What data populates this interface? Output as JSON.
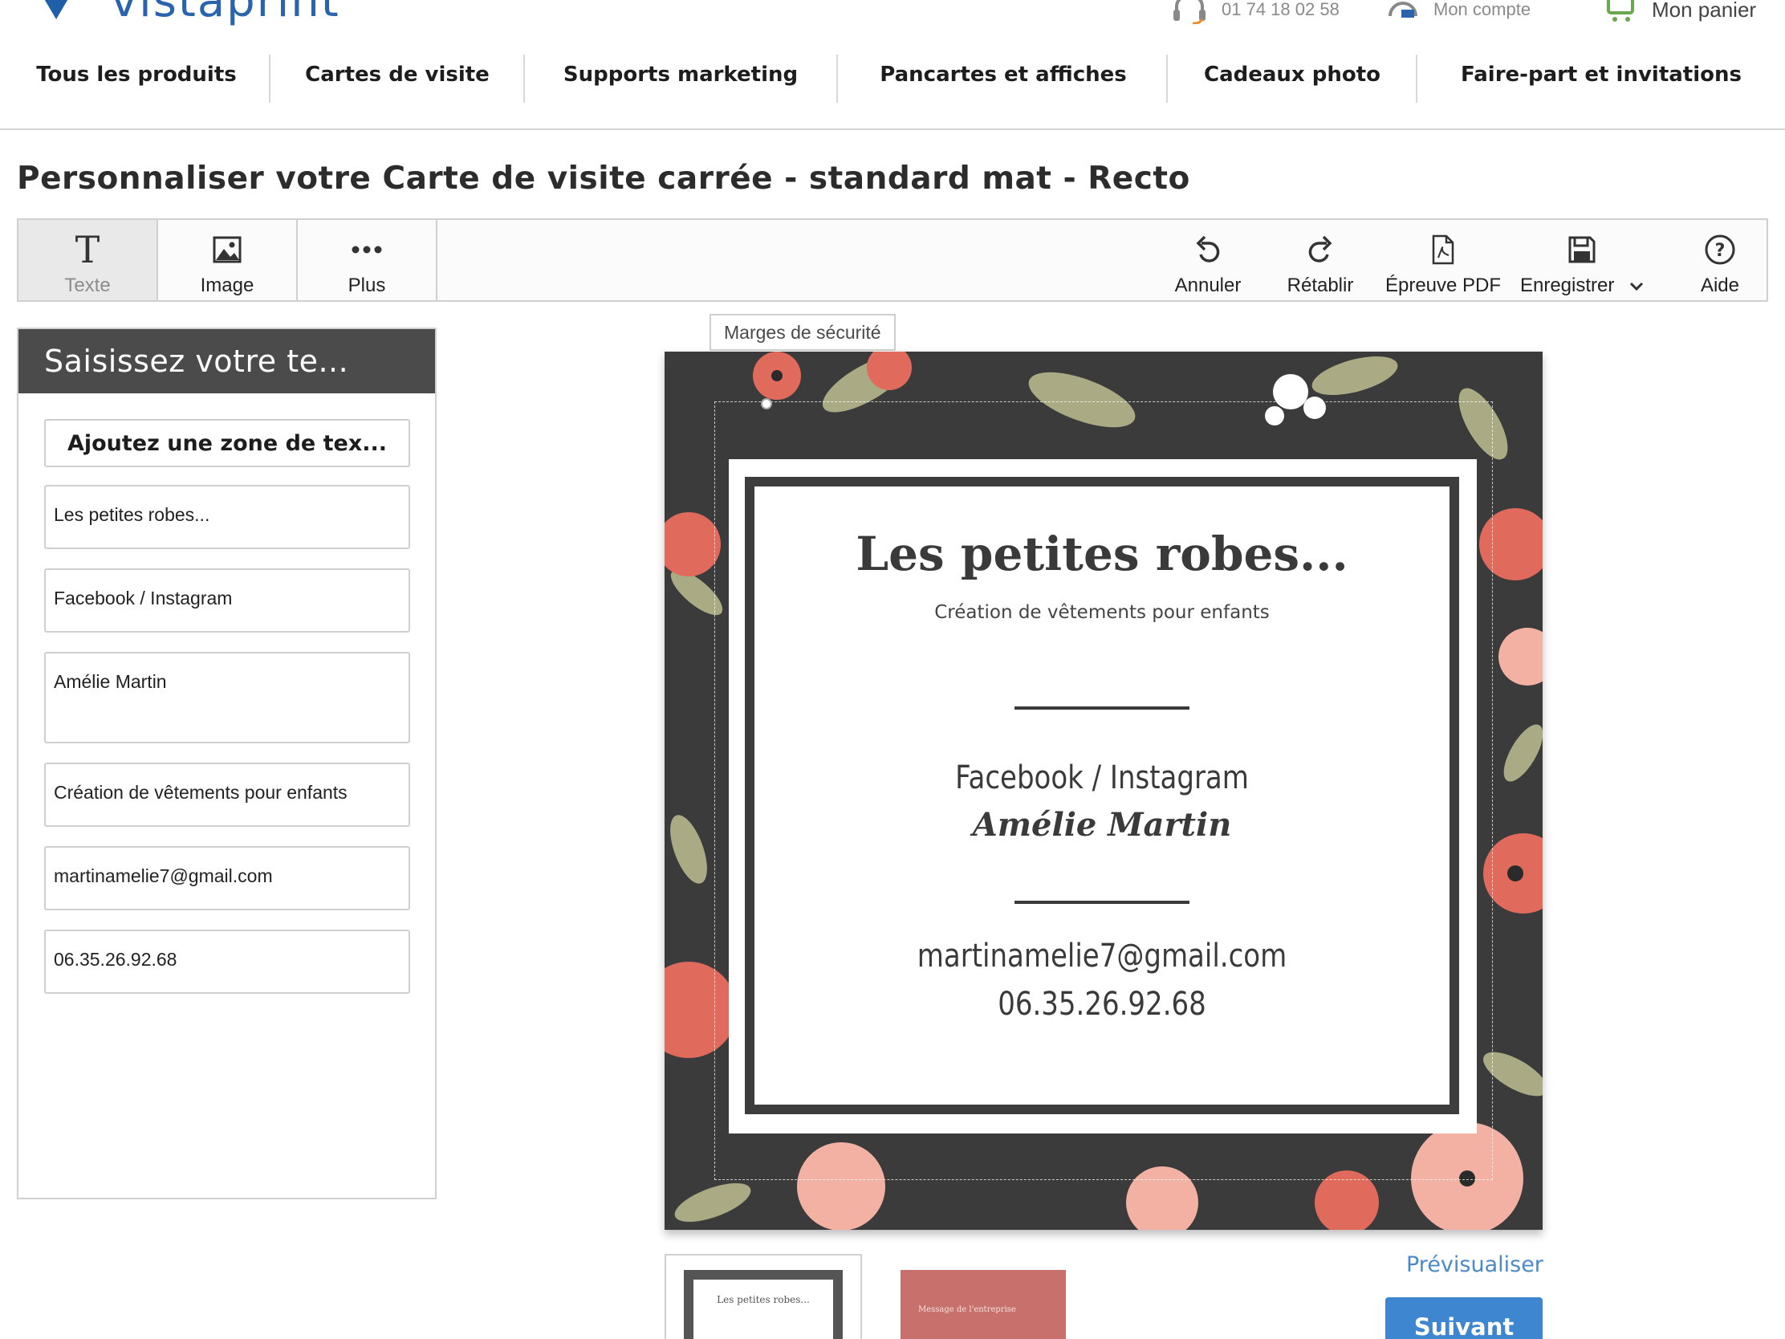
{
  "header": {
    "logo_text": "vistaprint",
    "phone": "01 74 18 02 58",
    "account_label": "Mon compte",
    "cart_label": "Mon panier",
    "brand_color": "#2a64ad"
  },
  "nav": {
    "items": [
      {
        "label": "Tous les produits"
      },
      {
        "label": "Cartes de visite"
      },
      {
        "label": "Supports marketing"
      },
      {
        "label": "Pancartes et affiches"
      },
      {
        "label": "Cadeaux photo"
      },
      {
        "label": "Faire-part et invitations"
      }
    ]
  },
  "page": {
    "title": "Personnaliser votre Carte de visite carrée - standard mat - Recto"
  },
  "toolbar": {
    "left": [
      {
        "label": "Texte",
        "icon": "text-icon",
        "active": true
      },
      {
        "label": "Image",
        "icon": "image-icon"
      },
      {
        "label": "Plus",
        "icon": "more-icon"
      }
    ],
    "right": [
      {
        "label": "Annuler",
        "icon": "undo-icon"
      },
      {
        "label": "Rétablir",
        "icon": "redo-icon"
      },
      {
        "label": "Épreuve PDF",
        "icon": "pdf-icon"
      },
      {
        "label": "Enregistrer",
        "icon": "save-icon",
        "has_dropdown": true
      },
      {
        "label": "Aide",
        "icon": "help-icon"
      }
    ]
  },
  "text_panel": {
    "header": "Saisissez votre te...",
    "add_button": "Ajoutez une zone de tex...",
    "fields": [
      {
        "value": "Les petites robes..."
      },
      {
        "value": "Facebook / Instagram"
      },
      {
        "value": "Amélie Martin"
      },
      {
        "value": "Création de vêtements pour enfants"
      },
      {
        "value": "martinamelie7@gmail.com"
      },
      {
        "value": "06.35.26.92.68"
      }
    ]
  },
  "canvas": {
    "safety_margin_label": "Marges de sécurité",
    "card": {
      "title": "Les petites robes...",
      "subtitle": "Création de vêtements pour enfants",
      "social": "Facebook / Instagram",
      "name": "Amélie Martin",
      "email": "martinamelie7@gmail.com",
      "phone": "06.35.26.92.68"
    }
  },
  "bottom": {
    "thumb1_text": "Les petites robes...",
    "thumb2_text": "Message de l'entreprise",
    "preview_link": "Prévisualiser",
    "next_button": "Suivant",
    "accent_color": "#3e86cf"
  }
}
